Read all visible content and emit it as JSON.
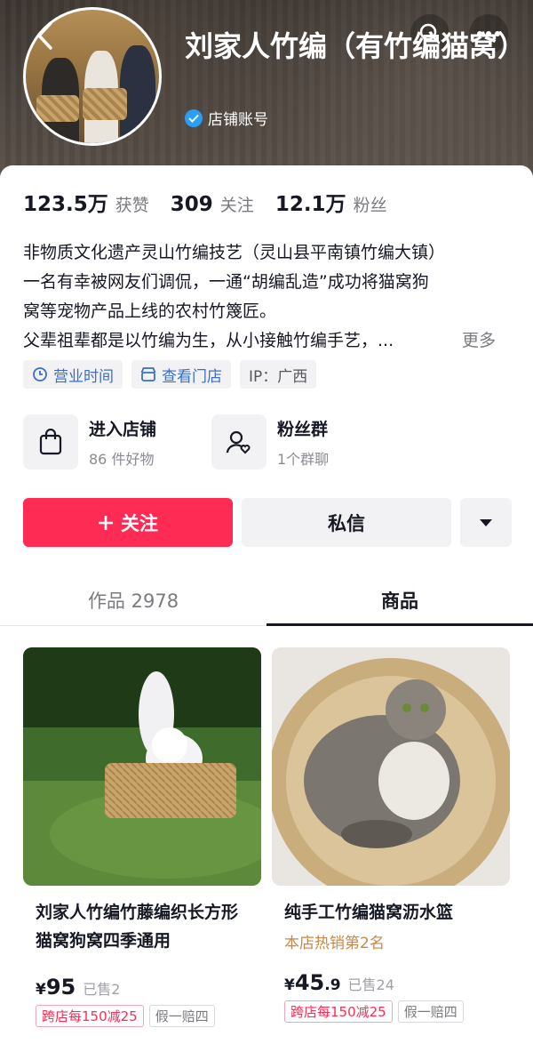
{
  "header": {
    "shop_name": "刘家人竹编（有竹编猫窝）",
    "account_type": "店铺账号",
    "icons": [
      "back-icon",
      "search-icon",
      "more-icon",
      "verified-icon"
    ]
  },
  "stats": [
    {
      "num": "123.5万",
      "label": "获赞"
    },
    {
      "num": "309",
      "label": "关注"
    },
    {
      "num": "12.1万",
      "label": "粉丝"
    }
  ],
  "bio": {
    "lines": [
      "非物质文化遗产灵山竹编技艺（灵山县平南镇竹编大镇）",
      "一名有幸被网友们调侃，一通“胡编乱造”成功将猫窝狗",
      "窝等宠物产品上线的农村竹篾匠。",
      "父辈祖辈都是以竹编为生，从小接触竹编手艺，..."
    ],
    "more": "更多"
  },
  "tags": [
    {
      "label": "营业时间",
      "icon": "clock-icon"
    },
    {
      "label": "查看门店",
      "icon": "store-icon"
    },
    {
      "label": "IP：广西"
    }
  ],
  "entries": [
    {
      "title": "进入店铺",
      "sub": "86 件好物",
      "icon": "shopping-bag-icon"
    },
    {
      "title": "粉丝群",
      "sub": "1个群聊",
      "icon": "fan-group-icon"
    }
  ],
  "actions": {
    "follow": "关注",
    "message": "私信"
  },
  "tabs": [
    {
      "label": "作品 2978"
    },
    {
      "label": "商品"
    }
  ],
  "products": [
    {
      "title": "刘家人竹编竹藤编织长方形猫窝狗窝四季通用",
      "rank": "",
      "currency": "¥",
      "price_int": "95",
      "price_dec": "",
      "sold": "已售2",
      "tag1": "跨店每150减25",
      "tag2": "假一赔四"
    },
    {
      "title": "纯手工竹编猫窝沥水篮",
      "rank": "本店热销第2名",
      "currency": "¥",
      "price_int": "45",
      "price_dec": ".9",
      "sold": "已售24",
      "tag1": "跨店每150减25",
      "tag2": "假一赔四"
    }
  ]
}
